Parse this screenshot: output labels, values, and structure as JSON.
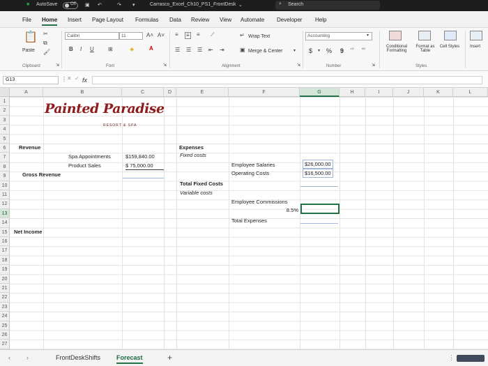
{
  "titlebar": {
    "autosave_label": "AutoSave",
    "autosave_state": "Off",
    "filename": "Carrasco_Excel_Ch10_PS1_FrontDesk",
    "search_placeholder": "Search"
  },
  "menu": [
    "File",
    "Home",
    "Insert",
    "Page Layout",
    "Formulas",
    "Data",
    "Review",
    "View",
    "Automate",
    "Developer",
    "Help"
  ],
  "ribbon": {
    "paste": "Paste",
    "font_name": "Calibri",
    "font_size": "11",
    "wrap_text": "Wrap Text",
    "merge_center": "Merge & Center",
    "number_format": "Accounting",
    "currency": "$",
    "percent": "%",
    "comma": "9",
    "conditional_formatting": "Conditional Formatting",
    "format_as_table": "Format as Table",
    "cell_styles": "Cell Styles",
    "insert": "Insert",
    "groups": {
      "clipboard": "Clipboard",
      "font": "Font",
      "alignment": "Alignment",
      "number": "Number",
      "styles": "Styles"
    }
  },
  "formula_bar": {
    "name_box": "G13",
    "fx": "fx",
    "value": ""
  },
  "columns": [
    "A",
    "B",
    "C",
    "D",
    "E",
    "F",
    "G",
    "H",
    "I",
    "J",
    "K",
    "L"
  ],
  "rows": [
    "1",
    "2",
    "3",
    "4",
    "5",
    "6",
    "7",
    "8",
    "9",
    "10",
    "11",
    "12",
    "13",
    "14",
    "15",
    "16",
    "17",
    "18",
    "19",
    "20",
    "21",
    "22",
    "23",
    "24",
    "25",
    "26",
    "27"
  ],
  "logo": {
    "title": "Painted Paradise",
    "subtitle": "RESORT & SPA"
  },
  "cells": {
    "a6": "Revenue",
    "b7": "Spa Appointments",
    "c7": "$159,840.00",
    "b8": "Product Sales",
    "c8": "$ 75,000.00",
    "a9": "Gross Revenue",
    "a15": "Net Income",
    "e6": "Expenses",
    "e7": "Fixed costs",
    "f8": "Employee Salaries",
    "g8": "$26,000.00",
    "f9": "Operating Costs",
    "g9": "$16,500.00",
    "e10": "Total Fixed Costs",
    "e11": "Variable costs",
    "f12": "Employee Commissions",
    "f13": "8.5%",
    "f14": "Total Expenses"
  },
  "sheets": {
    "tab1": "FrontDeskShifts",
    "tab2": "Forecast",
    "active": "Forecast"
  },
  "colors": {
    "accent": "#217346",
    "logo": "#8e1c1c"
  }
}
